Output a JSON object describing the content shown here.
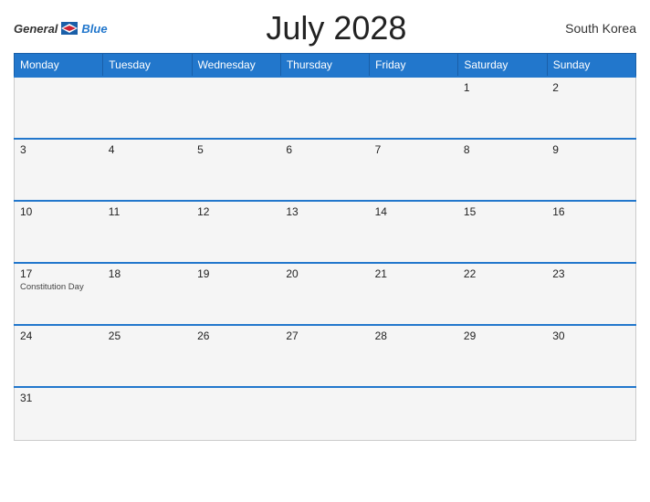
{
  "header": {
    "logo_general": "General",
    "logo_blue": "Blue",
    "title": "July 2028",
    "country": "South Korea"
  },
  "weekdays": [
    "Monday",
    "Tuesday",
    "Wednesday",
    "Thursday",
    "Friday",
    "Saturday",
    "Sunday"
  ],
  "weeks": [
    [
      {
        "day": "",
        "event": ""
      },
      {
        "day": "",
        "event": ""
      },
      {
        "day": "",
        "event": ""
      },
      {
        "day": "",
        "event": ""
      },
      {
        "day": "",
        "event": ""
      },
      {
        "day": "1",
        "event": ""
      },
      {
        "day": "2",
        "event": ""
      }
    ],
    [
      {
        "day": "3",
        "event": ""
      },
      {
        "day": "4",
        "event": ""
      },
      {
        "day": "5",
        "event": ""
      },
      {
        "day": "6",
        "event": ""
      },
      {
        "day": "7",
        "event": ""
      },
      {
        "day": "8",
        "event": ""
      },
      {
        "day": "9",
        "event": ""
      }
    ],
    [
      {
        "day": "10",
        "event": ""
      },
      {
        "day": "11",
        "event": ""
      },
      {
        "day": "12",
        "event": ""
      },
      {
        "day": "13",
        "event": ""
      },
      {
        "day": "14",
        "event": ""
      },
      {
        "day": "15",
        "event": ""
      },
      {
        "day": "16",
        "event": ""
      }
    ],
    [
      {
        "day": "17",
        "event": "Constitution Day"
      },
      {
        "day": "18",
        "event": ""
      },
      {
        "day": "19",
        "event": ""
      },
      {
        "day": "20",
        "event": ""
      },
      {
        "day": "21",
        "event": ""
      },
      {
        "day": "22",
        "event": ""
      },
      {
        "day": "23",
        "event": ""
      }
    ],
    [
      {
        "day": "24",
        "event": ""
      },
      {
        "day": "25",
        "event": ""
      },
      {
        "day": "26",
        "event": ""
      },
      {
        "day": "27",
        "event": ""
      },
      {
        "day": "28",
        "event": ""
      },
      {
        "day": "29",
        "event": ""
      },
      {
        "day": "30",
        "event": ""
      }
    ],
    [
      {
        "day": "31",
        "event": ""
      },
      {
        "day": "",
        "event": ""
      },
      {
        "day": "",
        "event": ""
      },
      {
        "day": "",
        "event": ""
      },
      {
        "day": "",
        "event": ""
      },
      {
        "day": "",
        "event": ""
      },
      {
        "day": "",
        "event": ""
      }
    ]
  ]
}
